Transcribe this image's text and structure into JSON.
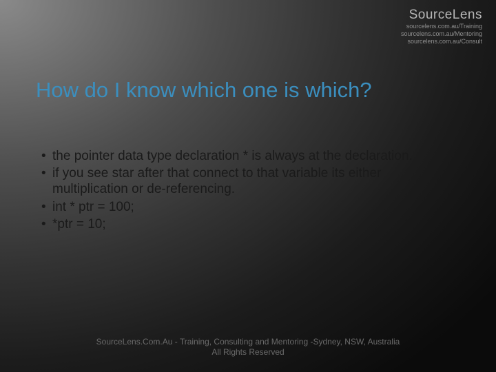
{
  "watermark": {
    "brand": "SourceLens",
    "lines": [
      "sourcelens.com.au/Training",
      "sourcelens.com.au/Mentoring",
      "sourcelens.com.au/Consult"
    ]
  },
  "title": "How do I know which one is which?",
  "bullets": [
    "the pointer data type declaration * is always at the declaration.",
    "if you see star after that connect to that variable its either multiplication or de-referencing.",
    "int * ptr = 100;",
    "*ptr = 10;"
  ],
  "footer": {
    "line1": "SourceLens.Com.Au - Training, Consulting and Mentoring -Sydney, NSW, Australia",
    "line2": "All Rights Reserved"
  }
}
